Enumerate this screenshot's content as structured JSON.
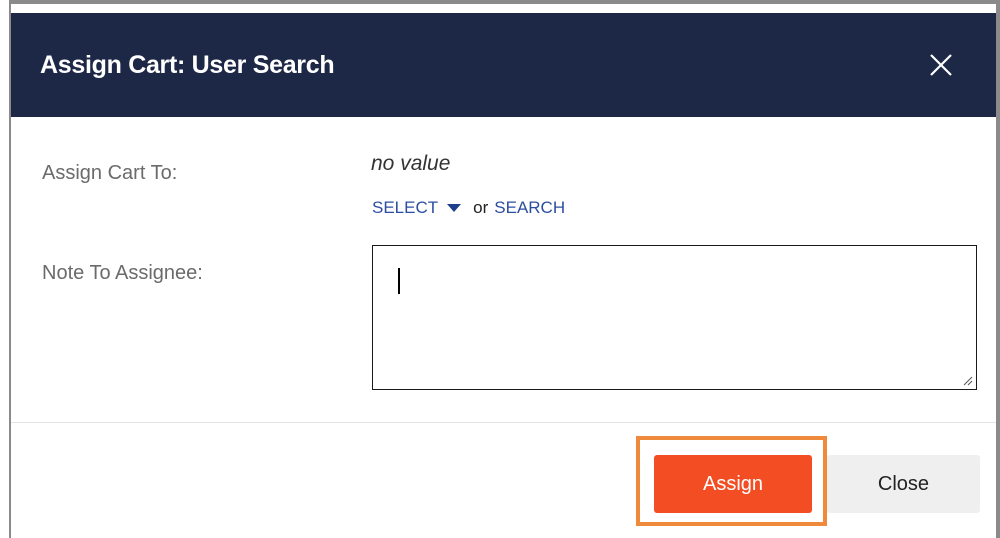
{
  "dialog": {
    "title": "Assign Cart: User Search",
    "close_icon": "close-x-icon",
    "header_color": "#1d2847"
  },
  "form": {
    "assign_label": "Assign Cart To:",
    "assign_value": "no value",
    "select_link": "SELECT",
    "or_text": "or",
    "search_link": "SEARCH",
    "note_label": "Note To Assignee:",
    "note_value": ""
  },
  "footer": {
    "assign_button": "Assign",
    "close_button": "Close",
    "assign_color": "#f24d23",
    "highlight_color": "#ef8a3c"
  }
}
